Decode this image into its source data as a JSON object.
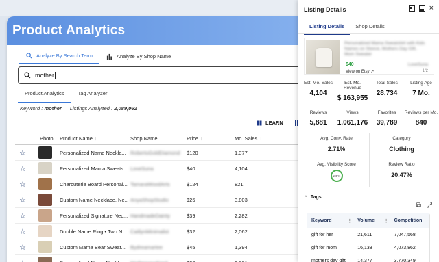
{
  "app": {
    "title": "Product Analytics"
  },
  "search_tabs": [
    {
      "label": "Analyze By Search Term",
      "active": true
    },
    {
      "label": "Analyze By Shop Name",
      "active": false
    }
  ],
  "search": {
    "value": "mother"
  },
  "sub_tabs": [
    {
      "label": "Product Analytics",
      "active": true
    },
    {
      "label": "Tag Analyzer",
      "active": false
    }
  ],
  "meta": {
    "keyword_label": "Keyword :",
    "keyword_value": "mother",
    "listings_label": "Listings Analyzed :",
    "listings_value": "2,089,062"
  },
  "toolbar": {
    "learn_label": "LEARN"
  },
  "table": {
    "columns": [
      "Photo",
      "Product Name",
      "Shop Name",
      "Price",
      "Mo. Sales"
    ],
    "rows": [
      {
        "name": "Personalized Name Neckla...",
        "shop": "RobertoGoldDiamond",
        "price": "$120",
        "sales": "1,377",
        "thumb": "#2a2a2a"
      },
      {
        "name": "Personalized Mama Sweats...",
        "shop": "LoveSuna",
        "price": "$40",
        "sales": "4,104",
        "thumb": "#d8d3c6"
      },
      {
        "name": "Charcuterie Board Personal...",
        "shop": "TamaraWoodArts",
        "price": "$124",
        "sales": "821",
        "thumb": "#a0724a"
      },
      {
        "name": "Custom Name Necklace, Ne...",
        "shop": "AnyaShopStudio",
        "price": "$25",
        "sales": "3,803",
        "thumb": "#7a4a3a"
      },
      {
        "name": "Personalized Signature Nec...",
        "shop": "HandmadeDainty",
        "price": "$39",
        "sales": "2,282",
        "thumb": "#c9a58a"
      },
      {
        "name": "Double Name Ring • Two N...",
        "shop": "CaitlynMinimalist",
        "price": "$32",
        "sales": "2,062",
        "thumb": "#e6d5c4"
      },
      {
        "name": "Custom Mama Bear Sweat...",
        "shop": "Bydreamartee",
        "price": "$45",
        "sales": "1,394",
        "thumb": "#d9cfb5"
      },
      {
        "name": "Personalized Name Neckla...",
        "shop": "NisPersonalized",
        "price": "$28",
        "sales": "2,801",
        "thumb": "#8a6a55"
      }
    ]
  },
  "panel": {
    "title": "Listing Details",
    "tabs": [
      {
        "label": "Listing Details",
        "active": true
      },
      {
        "label": "Shop Details",
        "active": false
      }
    ],
    "listing": {
      "title": "Personalized Mama Sweatshirt with Kids Names on Sleeve, Mothers Day Gift, Mom Sweater",
      "price": "$40",
      "shop": "LoveSuna",
      "link": "View on Etsy",
      "page": "1/2"
    },
    "stats": [
      {
        "label": "Est. Mo. Sales",
        "value": "4,104"
      },
      {
        "label": "Est. Mo. Revenue",
        "value": "$ 163,955"
      },
      {
        "label": "Total Sales",
        "value": "28,734"
      },
      {
        "label": "Listing Age",
        "value": "7 Mo."
      },
      {
        "label": "Reviews",
        "value": "5,881"
      },
      {
        "label": "Views",
        "value": "1,061,176"
      },
      {
        "label": "Favorites",
        "value": "39,789"
      },
      {
        "label": "Reviews per Mo.",
        "value": "840"
      }
    ],
    "metrics": {
      "conv_label": "Avg. Conv. Rate",
      "conv_value": "2.71%",
      "category_label": "Category",
      "category_value": "Clothing",
      "visibility_label": "Avg. Visibility Score",
      "visibility_value": "100%",
      "review_ratio_label": "Review Ratio",
      "review_ratio_value": "20.47%"
    },
    "tags_label": "Tags",
    "tags_columns": [
      "Keyword",
      "Volume",
      "Competition"
    ],
    "tags_rows": [
      {
        "keyword": "gift for her",
        "volume": "21,611",
        "competition": "7,047,568"
      },
      {
        "keyword": "gift for mom",
        "volume": "16,138",
        "competition": "4,073,862"
      },
      {
        "keyword": "mothers day gift",
        "volume": "14,377",
        "competition": "3,770,349"
      }
    ]
  }
}
